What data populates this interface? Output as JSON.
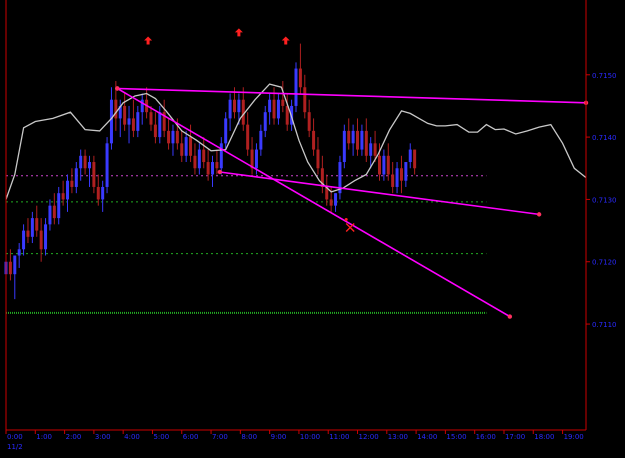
{
  "chart_data": {
    "type": "candlestick",
    "x_tick_labels": [
      "0:00",
      "1:00",
      "2:00",
      "3:00",
      "4:00",
      "5:00",
      "6:00",
      "7:00",
      "8:00",
      "9:00",
      "10:00",
      "11:00",
      "12:00",
      "13:00",
      "14:00",
      "15:00",
      "16:00",
      "17:00",
      "18:00",
      "19:00"
    ],
    "x_date_label": "11/2",
    "x_range_hours": [
      0,
      19.8
    ],
    "y_tick_labels": [
      "0.7150",
      "0.7140",
      "0.7130",
      "0.7120",
      "0.7110"
    ],
    "y_tick_values": [
      0.715,
      0.714,
      0.713,
      0.712,
      0.711
    ],
    "ylim": [
      0.7093,
      0.7162
    ],
    "colors": {
      "background": "#000000",
      "axis": "#cc0000",
      "tick_label": "#2a2aff",
      "bull_bar": "#3a3aff",
      "bear_bar": "#b02020",
      "neutral_bar": "#20b020",
      "trendline": "#ff00ff",
      "indicator": "#c8c8c8",
      "signal_marker": "#ff2020",
      "level_magenta": "#cc44cc",
      "level_green": "#22aa22"
    },
    "trendlines": [
      {
        "x": [
          3.8,
          19.8
        ],
        "y": [
          0.71478,
          0.71455
        ]
      },
      {
        "x": [
          3.8,
          17.2
        ],
        "y": [
          0.71478,
          0.71112
        ]
      },
      {
        "x": [
          7.3,
          18.2
        ],
        "y": [
          0.71344,
          0.71276
        ]
      }
    ],
    "horizontal_levels": [
      {
        "y": 0.71338,
        "x": [
          0,
          16.4
        ],
        "color": "level_magenta",
        "style": "dotted"
      },
      {
        "y": 0.71296,
        "x": [
          0,
          16.4
        ],
        "color": "level_green",
        "style": "dotted"
      },
      {
        "y": 0.71213,
        "x": [
          0,
          16.4
        ],
        "color": "level_green",
        "style": "dotted"
      },
      {
        "y": 0.71118,
        "x": [
          0,
          16.4
        ],
        "color": "level_green",
        "style": "dense"
      }
    ],
    "up_arrows": [
      {
        "x": 4.85,
        "y": 0.71555
      },
      {
        "x": 7.95,
        "y": 0.71568
      },
      {
        "x": 9.55,
        "y": 0.71555
      }
    ],
    "signal_marks": [
      {
        "x": 11.75,
        "y": 0.71255,
        "symbol": "x"
      }
    ],
    "indicator_line": {
      "x": [
        0,
        0.3,
        0.6,
        1.0,
        1.6,
        2.2,
        2.7,
        3.2,
        3.6,
        4.0,
        4.4,
        4.8,
        5.1,
        5.5,
        6.0,
        6.5,
        7.0,
        7.5,
        8.0,
        8.5,
        9.0,
        9.4,
        9.7,
        10.0,
        10.3,
        10.7,
        11.1,
        11.5,
        11.9,
        12.3,
        12.7,
        13.1,
        13.5,
        13.8,
        14.1,
        14.4,
        14.7,
        15.0,
        15.4,
        15.8,
        16.1,
        16.4,
        16.7,
        17.0,
        17.4,
        17.8,
        18.2,
        18.6,
        19.0,
        19.4,
        19.8
      ],
      "y": [
        0.713,
        0.7134,
        0.71415,
        0.71425,
        0.7143,
        0.7144,
        0.71412,
        0.7141,
        0.7143,
        0.71455,
        0.71466,
        0.7147,
        0.71462,
        0.7144,
        0.7141,
        0.71395,
        0.71378,
        0.7138,
        0.7143,
        0.7146,
        0.71485,
        0.7148,
        0.7144,
        0.71395,
        0.7136,
        0.7133,
        0.71312,
        0.71318,
        0.7133,
        0.7134,
        0.71372,
        0.71412,
        0.71442,
        0.71438,
        0.7143,
        0.71422,
        0.71418,
        0.71418,
        0.7142,
        0.71408,
        0.71408,
        0.7142,
        0.71412,
        0.71413,
        0.71405,
        0.7141,
        0.71416,
        0.7142,
        0.7139,
        0.7135,
        0.71335
      ]
    },
    "candles": [
      [
        0.0,
        0.7118,
        0.7121,
        0.7112,
        0.712
      ],
      [
        0.15,
        0.712,
        0.7122,
        0.7117,
        0.7118
      ],
      [
        0.3,
        0.7118,
        0.7121,
        0.7114,
        0.7121
      ],
      [
        0.45,
        0.7121,
        0.7123,
        0.7119,
        0.7122
      ],
      [
        0.6,
        0.7122,
        0.7126,
        0.7121,
        0.7125
      ],
      [
        0.75,
        0.7125,
        0.7127,
        0.7123,
        0.7124
      ],
      [
        0.9,
        0.7124,
        0.7128,
        0.7123,
        0.7127
      ],
      [
        1.05,
        0.7127,
        0.7129,
        0.7124,
        0.7125
      ],
      [
        1.2,
        0.7125,
        0.7127,
        0.712,
        0.7122
      ],
      [
        1.35,
        0.7122,
        0.7127,
        0.7121,
        0.7126
      ],
      [
        1.5,
        0.7126,
        0.713,
        0.7125,
        0.7129
      ],
      [
        1.65,
        0.7129,
        0.7131,
        0.7126,
        0.7127
      ],
      [
        1.8,
        0.7127,
        0.7132,
        0.7126,
        0.7131
      ],
      [
        1.95,
        0.7131,
        0.7133,
        0.7129,
        0.713
      ],
      [
        2.1,
        0.713,
        0.7134,
        0.7128,
        0.7133
      ],
      [
        2.25,
        0.7133,
        0.7135,
        0.7131,
        0.7132
      ],
      [
        2.4,
        0.7132,
        0.7136,
        0.7131,
        0.7135
      ],
      [
        2.55,
        0.7135,
        0.7138,
        0.7133,
        0.7137
      ],
      [
        2.7,
        0.7137,
        0.7138,
        0.7134,
        0.7135
      ],
      [
        2.85,
        0.7135,
        0.7137,
        0.7132,
        0.7136
      ],
      [
        3.0,
        0.7136,
        0.7137,
        0.7131,
        0.7132
      ],
      [
        3.15,
        0.7132,
        0.7134,
        0.7129,
        0.713
      ],
      [
        3.3,
        0.713,
        0.7133,
        0.7128,
        0.7132
      ],
      [
        3.45,
        0.7132,
        0.714,
        0.7131,
        0.7139
      ],
      [
        3.6,
        0.7139,
        0.7148,
        0.7138,
        0.7146
      ],
      [
        3.75,
        0.7146,
        0.7149,
        0.7141,
        0.7143
      ],
      [
        3.9,
        0.7143,
        0.7146,
        0.714,
        0.7145
      ],
      [
        4.05,
        0.7145,
        0.7147,
        0.7141,
        0.7142
      ],
      [
        4.2,
        0.7142,
        0.7145,
        0.7139,
        0.7143
      ],
      [
        4.35,
        0.7143,
        0.7146,
        0.714,
        0.7141
      ],
      [
        4.5,
        0.7141,
        0.7145,
        0.714,
        0.7144
      ],
      [
        4.65,
        0.7144,
        0.7147,
        0.7142,
        0.7146
      ],
      [
        4.8,
        0.7146,
        0.7148,
        0.7143,
        0.7144
      ],
      [
        4.95,
        0.7144,
        0.7145,
        0.7141,
        0.7142
      ],
      [
        5.1,
        0.7142,
        0.7144,
        0.7139,
        0.714
      ],
      [
        5.25,
        0.714,
        0.7145,
        0.7139,
        0.7144
      ],
      [
        5.4,
        0.7144,
        0.7146,
        0.714,
        0.7141
      ],
      [
        5.55,
        0.7141,
        0.7143,
        0.7138,
        0.7139
      ],
      [
        5.7,
        0.7139,
        0.7142,
        0.7137,
        0.7141
      ],
      [
        5.85,
        0.7141,
        0.7143,
        0.7138,
        0.7139
      ],
      [
        6.0,
        0.7139,
        0.7141,
        0.7136,
        0.7137
      ],
      [
        6.15,
        0.7137,
        0.7141,
        0.7136,
        0.714
      ],
      [
        6.3,
        0.714,
        0.7142,
        0.7136,
        0.7137
      ],
      [
        6.45,
        0.7137,
        0.7139,
        0.7134,
        0.7135
      ],
      [
        6.6,
        0.7135,
        0.7139,
        0.7134,
        0.7138
      ],
      [
        6.75,
        0.7138,
        0.714,
        0.7135,
        0.7136
      ],
      [
        6.9,
        0.7136,
        0.7138,
        0.7133,
        0.7134
      ],
      [
        7.05,
        0.7134,
        0.7137,
        0.7132,
        0.7136
      ],
      [
        7.2,
        0.7136,
        0.7138,
        0.7134,
        0.7135
      ],
      [
        7.35,
        0.7135,
        0.714,
        0.7134,
        0.7139
      ],
      [
        7.5,
        0.7139,
        0.7144,
        0.7138,
        0.7143
      ],
      [
        7.65,
        0.7143,
        0.7147,
        0.7141,
        0.7146
      ],
      [
        7.8,
        0.7146,
        0.7148,
        0.7143,
        0.7144
      ],
      [
        7.95,
        0.7144,
        0.7147,
        0.7142,
        0.7146
      ],
      [
        8.1,
        0.7146,
        0.7148,
        0.7141,
        0.7142
      ],
      [
        8.25,
        0.7142,
        0.7144,
        0.7137,
        0.7138
      ],
      [
        8.4,
        0.7138,
        0.714,
        0.7134,
        0.7135
      ],
      [
        8.55,
        0.7135,
        0.7139,
        0.7134,
        0.7138
      ],
      [
        8.7,
        0.7138,
        0.7142,
        0.7137,
        0.7141
      ],
      [
        8.85,
        0.7141,
        0.7145,
        0.714,
        0.7144
      ],
      [
        9.0,
        0.7144,
        0.7147,
        0.7142,
        0.7146
      ],
      [
        9.15,
        0.7146,
        0.7148,
        0.7142,
        0.7143
      ],
      [
        9.3,
        0.7143,
        0.7147,
        0.7142,
        0.7146
      ],
      [
        9.45,
        0.7146,
        0.7149,
        0.7144,
        0.7145
      ],
      [
        9.6,
        0.7145,
        0.7147,
        0.7141,
        0.7142
      ],
      [
        9.75,
        0.7142,
        0.7146,
        0.7141,
        0.7145
      ],
      [
        9.9,
        0.7145,
        0.7152,
        0.7144,
        0.7151
      ],
      [
        10.05,
        0.7151,
        0.7155,
        0.7147,
        0.7148
      ],
      [
        10.2,
        0.7148,
        0.715,
        0.7143,
        0.7144
      ],
      [
        10.35,
        0.7144,
        0.7146,
        0.714,
        0.7141
      ],
      [
        10.5,
        0.7141,
        0.7143,
        0.7137,
        0.7138
      ],
      [
        10.65,
        0.7138,
        0.714,
        0.7134,
        0.7135
      ],
      [
        10.8,
        0.7135,
        0.7137,
        0.7131,
        0.7132
      ],
      [
        10.95,
        0.7132,
        0.7134,
        0.7129,
        0.713
      ],
      [
        11.1,
        0.713,
        0.7132,
        0.7128,
        0.7129
      ],
      [
        11.25,
        0.7129,
        0.7131,
        0.7128,
        0.7131
      ],
      [
        11.4,
        0.7131,
        0.7137,
        0.713,
        0.7136
      ],
      [
        11.55,
        0.7136,
        0.7142,
        0.7135,
        0.7141
      ],
      [
        11.7,
        0.7141,
        0.7143,
        0.7138,
        0.7139
      ],
      [
        11.85,
        0.7139,
        0.7142,
        0.7137,
        0.7141
      ],
      [
        12.0,
        0.7141,
        0.7143,
        0.7137,
        0.7138
      ],
      [
        12.15,
        0.7138,
        0.7142,
        0.7137,
        0.7141
      ],
      [
        12.3,
        0.7141,
        0.7143,
        0.7136,
        0.7137
      ],
      [
        12.45,
        0.7137,
        0.714,
        0.7135,
        0.7139
      ],
      [
        12.6,
        0.7139,
        0.7141,
        0.7136,
        0.7137
      ],
      [
        12.75,
        0.7137,
        0.7139,
        0.7133,
        0.7134
      ],
      [
        12.9,
        0.7134,
        0.7138,
        0.7133,
        0.7137
      ],
      [
        13.05,
        0.7137,
        0.7139,
        0.7133,
        0.7134
      ],
      [
        13.2,
        0.7134,
        0.7136,
        0.7131,
        0.7132
      ],
      [
        13.35,
        0.7132,
        0.7136,
        0.7131,
        0.7135
      ],
      [
        13.5,
        0.7135,
        0.7137,
        0.7131,
        0.7133
      ],
      [
        13.65,
        0.7133,
        0.7136,
        0.7132,
        0.7136
      ],
      [
        13.8,
        0.7136,
        0.7139,
        0.7135,
        0.7138
      ],
      [
        13.95,
        0.7138,
        0.7138,
        0.7134,
        0.7135
      ]
    ]
  }
}
